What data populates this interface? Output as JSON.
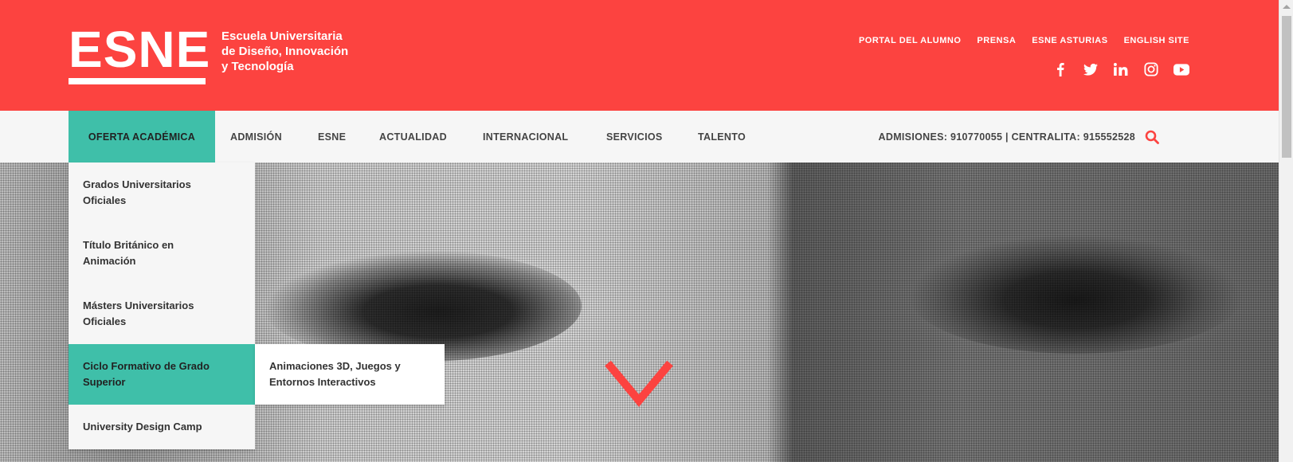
{
  "brand": {
    "logo_word": "ESNE",
    "logo_line1": "Escuela Universitaria",
    "logo_line2": "de Diseño, Innovación",
    "logo_line3": "y Tecnología",
    "accent_red": "#fc4340",
    "accent_teal": "#3fbfa9"
  },
  "top_links": [
    "PORTAL DEL ALUMNO",
    "PRENSA",
    "ESNE ASTURIAS",
    "ENGLISH SITE"
  ],
  "social_icons": [
    "facebook-icon",
    "twitter-icon",
    "linkedin-icon",
    "instagram-icon",
    "youtube-icon"
  ],
  "nav": {
    "items": [
      "OFERTA ACADÉMICA",
      "ADMISIÓN",
      "ESNE",
      "ACTUALIDAD",
      "INTERNACIONAL",
      "SERVICIOS",
      "TALENTO"
    ],
    "phones": "ADMISIONES: 910770055 | CENTRALITA: 915552528"
  },
  "dropdown": {
    "items": [
      {
        "line1": "Grados Universitarios",
        "line2": "Oficiales"
      },
      {
        "line1": "Título Británico en",
        "line2": "Animación"
      },
      {
        "line1": "Másters Universitarios",
        "line2": "Oficiales"
      },
      {
        "line1": "Ciclo Formativo de Grado",
        "line2": "Superior"
      },
      {
        "line1": "University Design Camp",
        "line2": ""
      }
    ],
    "submenu": {
      "line1": "Animaciones 3D, Juegos y",
      "line2": "Entornos Interactivos"
    }
  }
}
